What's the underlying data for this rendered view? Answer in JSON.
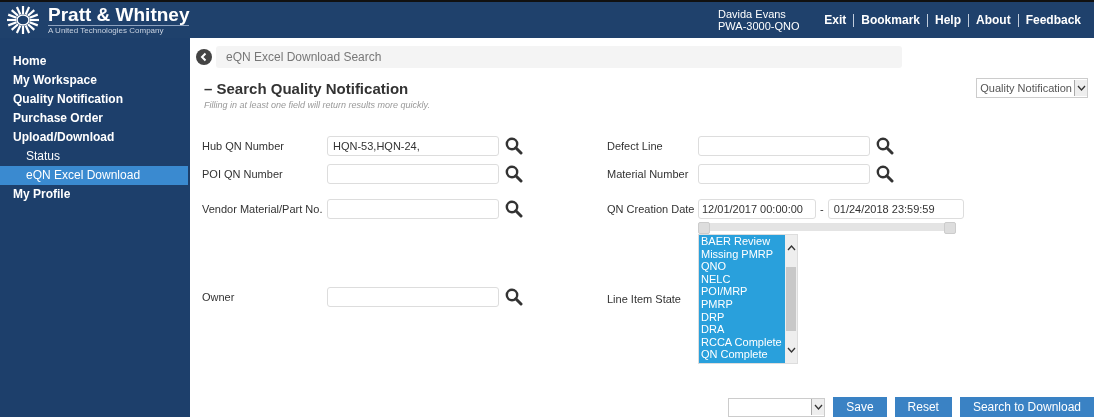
{
  "header": {
    "brand": "Pratt & Whitney",
    "tagline": "A United Technologies Company",
    "user_name": "Davida Evans",
    "user_role": "PWA-3000-QNO",
    "links": [
      "Exit",
      "Bookmark",
      "Help",
      "About",
      "Feedback"
    ]
  },
  "sidebar": {
    "items": [
      {
        "label": "Home",
        "selected": false
      },
      {
        "label": "My Workspace",
        "selected": false
      },
      {
        "label": "Quality Notification",
        "selected": false
      },
      {
        "label": "Purchase Order",
        "selected": false
      },
      {
        "label": "Upload/Download",
        "selected": false,
        "children": [
          {
            "label": "Status",
            "selected": false
          },
          {
            "label": "eQN Excel Download",
            "selected": true
          }
        ]
      },
      {
        "label": "My Profile",
        "selected": false
      }
    ]
  },
  "breadcrumb": "eQN Excel Download Search",
  "section_title": "– Search Quality Notification",
  "type_select": "Quality Notification",
  "hint": "Filling in at least one field will return results more quickly.",
  "left_fields": [
    {
      "label": "Hub QN Number",
      "value": "HQN-53,HQN-24,"
    },
    {
      "label": "POI QN Number"
    },
    {
      "label": "Vendor Material/Part No."
    },
    {
      "label": "Owner"
    }
  ],
  "right_fields": [
    {
      "label": "Defect Line"
    },
    {
      "label": "Material Number"
    }
  ],
  "creation_date": {
    "label": "QN Creation Date",
    "from": "12/01/2017 00:00:00",
    "separator": "-",
    "to": "01/24/2018 23:59:59",
    "slider": {
      "thumbs": [
        {
          "level": 0
        },
        {
          "level": 1
        }
      ]
    }
  },
  "line_item_state": {
    "label": "Line Item State",
    "options": [
      {
        "label": "BAER Review",
        "selected": true
      },
      {
        "label": "Missing PMRP",
        "selected": true
      },
      {
        "label": "QNO",
        "selected": true
      },
      {
        "label": "NELC",
        "selected": true
      },
      {
        "label": "POI/MRP",
        "selected": true
      },
      {
        "label": "PMRP",
        "selected": true
      },
      {
        "label": "DRP",
        "selected": true
      },
      {
        "label": "DRA",
        "selected": true
      },
      {
        "label": "RCCA Complete",
        "selected": true
      },
      {
        "label": "QN Complete",
        "selected": true
      }
    ]
  },
  "buttons": [
    "Save",
    "Reset",
    "Search to Download"
  ]
}
